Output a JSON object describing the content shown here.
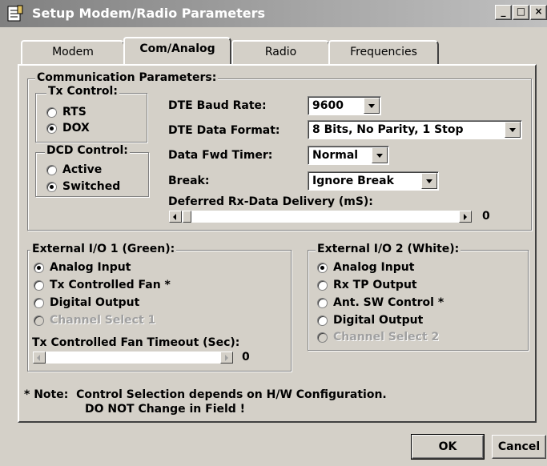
{
  "window": {
    "title": "Setup Modem/Radio Parameters",
    "icon": "document-icon",
    "buttons": {
      "minimize": "_",
      "maximize": "□",
      "close": "×"
    }
  },
  "tabs": [
    {
      "label": "Modem",
      "active": false
    },
    {
      "label": "Com/Analog",
      "active": true
    },
    {
      "label": "Radio",
      "active": false
    },
    {
      "label": "Frequencies",
      "active": false
    }
  ],
  "comm": {
    "legend": "Communication Parameters:",
    "tx_control": {
      "legend": "Tx Control:",
      "options": [
        "RTS",
        "DOX"
      ],
      "selected": "DOX"
    },
    "dcd_control": {
      "legend": "DCD Control:",
      "options": [
        "Active",
        "Switched"
      ],
      "selected": "Switched"
    },
    "dte_baud_rate": {
      "label": "DTE Baud Rate:",
      "value": "9600"
    },
    "dte_data_format": {
      "label": "DTE Data Format:",
      "value": "8 Bits, No Parity, 1 Stop"
    },
    "data_fwd_timer": {
      "label": "Data Fwd Timer:",
      "value": "Normal"
    },
    "break": {
      "label": "Break:",
      "value": "Ignore Break"
    },
    "deferred_rx": {
      "label": "Deferred Rx-Data Delivery (mS):",
      "value": "0"
    }
  },
  "ext_io_1": {
    "legend": "External I/O 1 (Green):",
    "options": [
      {
        "label": "Analog Input",
        "selected": true,
        "disabled": false
      },
      {
        "label": "Tx Controlled Fan *",
        "selected": false,
        "disabled": false
      },
      {
        "label": "Digital Output",
        "selected": false,
        "disabled": false
      },
      {
        "label": "Channel Select 1",
        "selected": false,
        "disabled": true
      }
    ],
    "fan_timeout": {
      "label": "Tx Controlled Fan Timeout (Sec):",
      "value": "0"
    }
  },
  "ext_io_2": {
    "legend": "External I/O 2 (White):",
    "options": [
      {
        "label": "Analog Input",
        "selected": true,
        "disabled": false
      },
      {
        "label": "Rx TP Output",
        "selected": false,
        "disabled": false
      },
      {
        "label": "Ant. SW Control *",
        "selected": false,
        "disabled": false
      },
      {
        "label": "Digital Output",
        "selected": false,
        "disabled": false
      },
      {
        "label": "Channel Select 2",
        "selected": false,
        "disabled": true
      }
    ]
  },
  "note": {
    "line1": "* Note:  Control Selection depends on H/W Configuration.",
    "line2": "DO NOT Change in Field !"
  },
  "footer": {
    "ok": "OK",
    "cancel": "Cancel"
  }
}
